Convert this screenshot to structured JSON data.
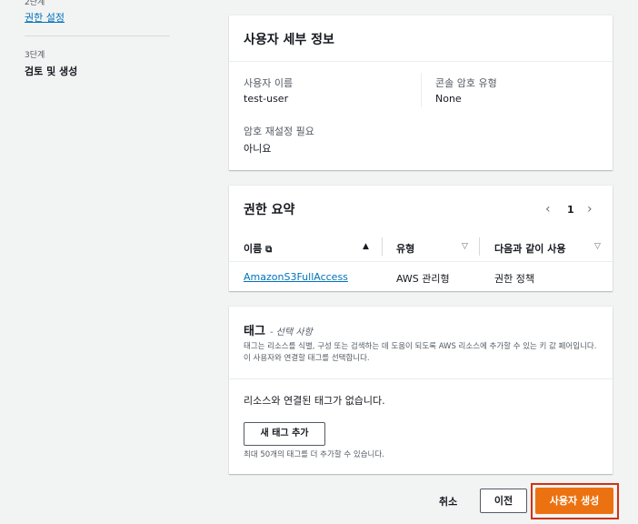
{
  "sidebar": {
    "step2_label": "2단계",
    "step2_link": "권한 설정",
    "step3_label": "3단계",
    "step3_current": "검토 및 생성"
  },
  "user_details": {
    "title": "사용자 세부 정보",
    "username_label": "사용자 이름",
    "username_value": "test-user",
    "console_pw_type_label": "콘솔 암호 유형",
    "console_pw_type_value": "None",
    "pw_reset_label": "암호 재설정 필요",
    "pw_reset_value": "아니요"
  },
  "permissions": {
    "title": "권한 요약",
    "page": "1",
    "columns": [
      "이름",
      "유형",
      "다음과 같이 사용"
    ],
    "rows": [
      {
        "name": "AmazonS3FullAccess",
        "type": "AWS 관리형",
        "used_as": "권한 정책"
      }
    ]
  },
  "tags": {
    "title": "태그",
    "optional": "- 선택 사항",
    "description": "태그는 리소스를 식별, 구성 또는 검색하는 데 도움이 되도록 AWS 리소스에 추가할 수 있는 키 값 페어입니다. 이 사용자와 연결할 태그를 선택합니다.",
    "empty_text": "리소스와 연결된 태그가 없습니다.",
    "add_button": "새 태그 추가",
    "limit_text": "최대 50개의 태그를 더 추가할 수 있습니다."
  },
  "footer": {
    "cancel": "취소",
    "previous": "이전",
    "create": "사용자 생성"
  },
  "colors": {
    "primary": "#ec7211",
    "link": "#0073bb",
    "highlight": "#d13212"
  }
}
